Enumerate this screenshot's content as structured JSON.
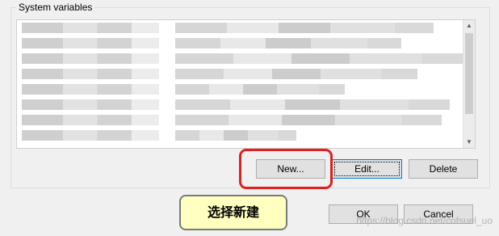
{
  "group": {
    "legend": "System variables"
  },
  "list": {
    "row_count": 8,
    "scroll_up": "▲",
    "scroll_down": "▼"
  },
  "buttons": {
    "new": "New...",
    "edit": "Edit...",
    "delete": "Delete",
    "ok": "OK",
    "cancel": "Cancel"
  },
  "annotation": {
    "callout": "选择新建"
  },
  "watermark": "https://blog.csdn.net/cofsuel_uo",
  "colors": {
    "highlight": "#e02020",
    "callout_bg": "#ffffc0",
    "focus": "#0078d7"
  }
}
